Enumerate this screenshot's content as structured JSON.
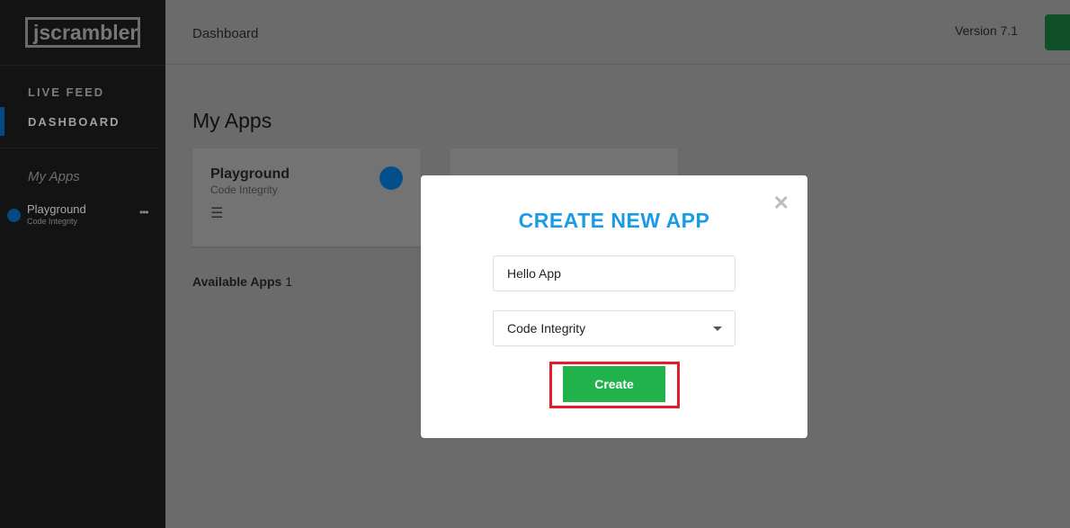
{
  "sidebar": {
    "logo": "jscrambler",
    "nav": [
      {
        "label": "LIVE FEED"
      },
      {
        "label": "DASHBOARD",
        "active": true
      }
    ],
    "section": "My Apps",
    "apps": [
      {
        "name": "Playground",
        "type": "Code Integrity",
        "more": "•••"
      }
    ]
  },
  "header": {
    "breadcrumb": "Dashboard",
    "version": "Version 7.1"
  },
  "main": {
    "title": "My Apps",
    "cards": [
      {
        "name": "Playground",
        "type": "Code Integrity",
        "menu": "☰"
      }
    ],
    "available_label": "Available Apps",
    "available_count": "1"
  },
  "modal": {
    "title": "CREATE NEW APP",
    "close": "✕",
    "name_value": "Hello App",
    "type_value": "Code Integrity",
    "create_label": "Create"
  },
  "colors": {
    "accent": "#1a9be6",
    "primary": "#22b24c",
    "highlight": "#e21d2a"
  }
}
